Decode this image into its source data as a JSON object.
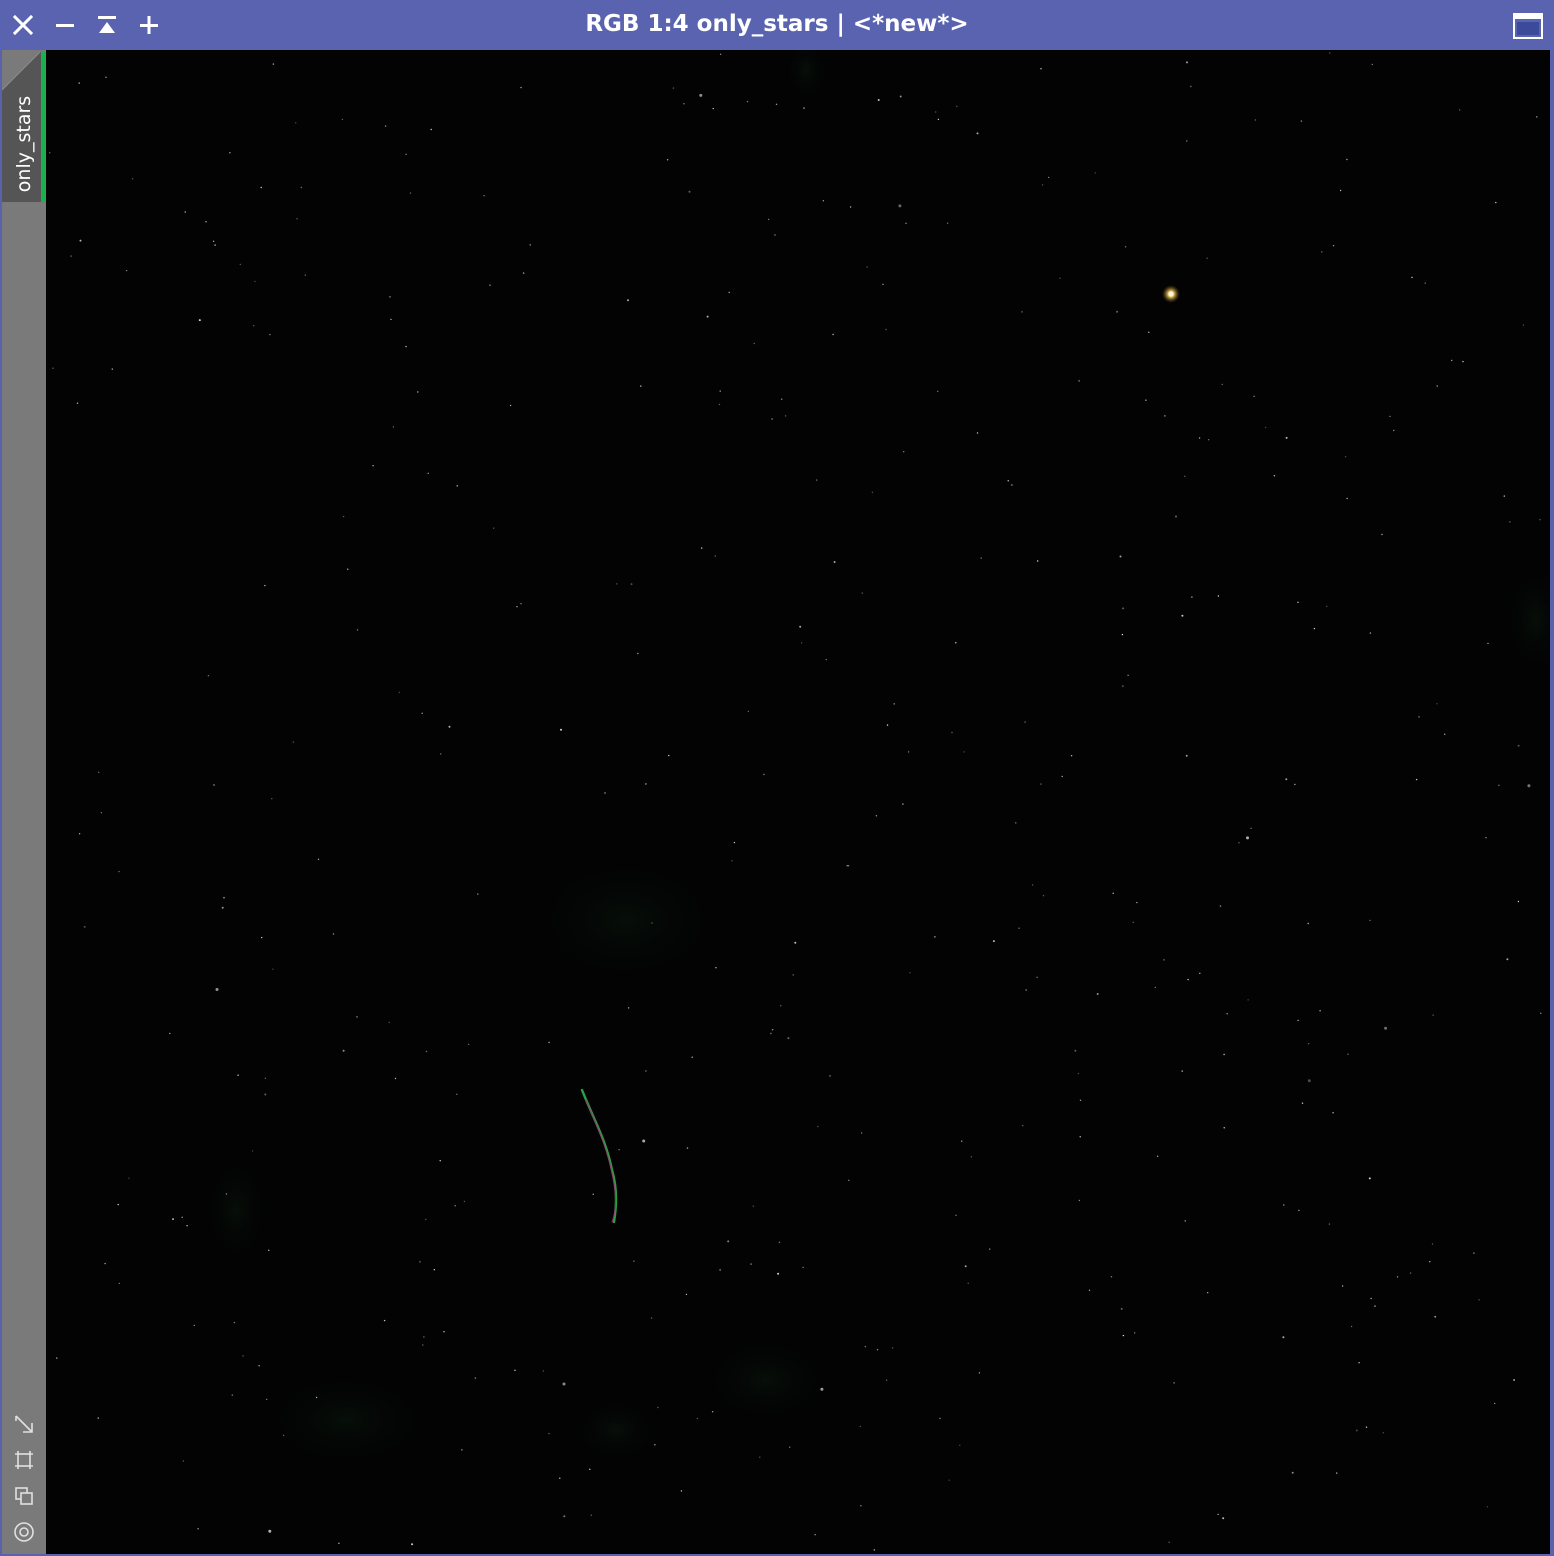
{
  "window": {
    "title": "RGB 1:4 only_stars | <*new*>"
  },
  "titlebar_buttons": [
    {
      "name": "close-button",
      "icon": "close-icon"
    },
    {
      "name": "minimize-button",
      "icon": "minimize-icon"
    },
    {
      "name": "shade-button",
      "icon": "shade-icon"
    },
    {
      "name": "maximize-button",
      "icon": "plus-icon"
    }
  ],
  "view_tab": {
    "label": "only_stars",
    "accent_color": "#19b050"
  },
  "sidebar_tools": [
    {
      "name": "resize-icon"
    },
    {
      "name": "fit-view-icon"
    },
    {
      "name": "clone-icon"
    },
    {
      "name": "target-icon"
    }
  ],
  "colors": {
    "titlebar": "#5a63b0",
    "canvas_background": "#030304",
    "bright_star": "#fff2c0"
  }
}
